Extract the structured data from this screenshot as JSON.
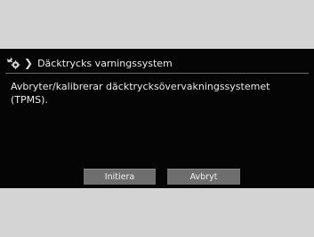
{
  "header": {
    "icon": "settings-icon",
    "title": "Däcktrycks varningssystem"
  },
  "main": {
    "message_line1": "Avbryter/kalibrerar däcktrycksövervakningssystemet",
    "message_line2": "(TPMS)."
  },
  "buttons": {
    "initiera_label": "Initiera",
    "avbryt_label": "Avbryt"
  }
}
